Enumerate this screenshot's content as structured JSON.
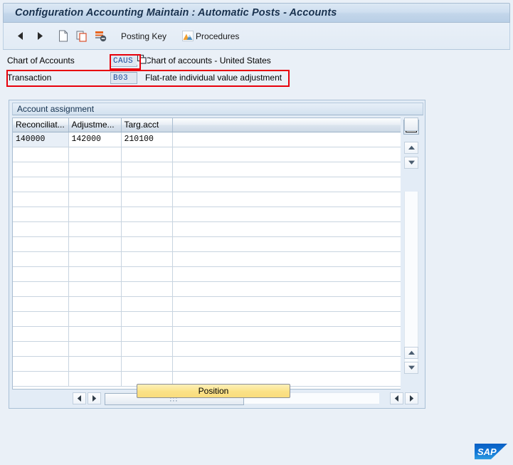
{
  "window": {
    "title": "Configuration Accounting Maintain : Automatic Posts - Accounts"
  },
  "toolbar": {
    "items": [
      {
        "name": "back-arrow-icon",
        "label": "",
        "icon": "triangle-left-icon"
      },
      {
        "name": "forward-arrow-icon",
        "label": "",
        "icon": "triangle-right-icon"
      },
      {
        "name": "new-entries-icon",
        "label": "",
        "icon": "page-icon"
      },
      {
        "name": "copy-as-icon",
        "label": "",
        "icon": "copy-icon"
      },
      {
        "name": "delete-icon",
        "label": "",
        "icon": "delete-row-icon"
      }
    ],
    "posting_key_label": "Posting Key",
    "procedures_label": "Procedures"
  },
  "form": {
    "chart_of_accounts": {
      "label": "Chart of Accounts",
      "value": "CAUS",
      "description": "Chart of accounts - United States"
    },
    "transaction": {
      "label": "Transaction",
      "value": "B03",
      "description": "Flat-rate individual value adjustment"
    }
  },
  "group": {
    "title": "Account assignment"
  },
  "grid": {
    "columns": [
      "Reconciliat...",
      "Adjustme...",
      "Targ.acct"
    ],
    "rows": [
      [
        "140000",
        "142000",
        "210100"
      ],
      [
        "",
        "",
        ""
      ],
      [
        "",
        "",
        ""
      ],
      [
        "",
        "",
        ""
      ],
      [
        "",
        "",
        ""
      ],
      [
        "",
        "",
        ""
      ],
      [
        "",
        "",
        ""
      ],
      [
        "",
        "",
        ""
      ],
      [
        "",
        "",
        ""
      ],
      [
        "",
        "",
        ""
      ],
      [
        "",
        "",
        ""
      ],
      [
        "",
        "",
        ""
      ],
      [
        "",
        "",
        ""
      ],
      [
        "",
        "",
        ""
      ],
      [
        "",
        "",
        ""
      ],
      [
        "",
        "",
        ""
      ],
      [
        "",
        "",
        ""
      ]
    ]
  },
  "footer": {
    "position_label": "Position"
  },
  "branding": {
    "logo_text": "SAP"
  },
  "colors": {
    "accent_blue": "#1a4f9c",
    "annotation_red": "#e8000b",
    "button_yellow": "#fbe48e",
    "sap_logo_blue": "#0a6ed1"
  }
}
